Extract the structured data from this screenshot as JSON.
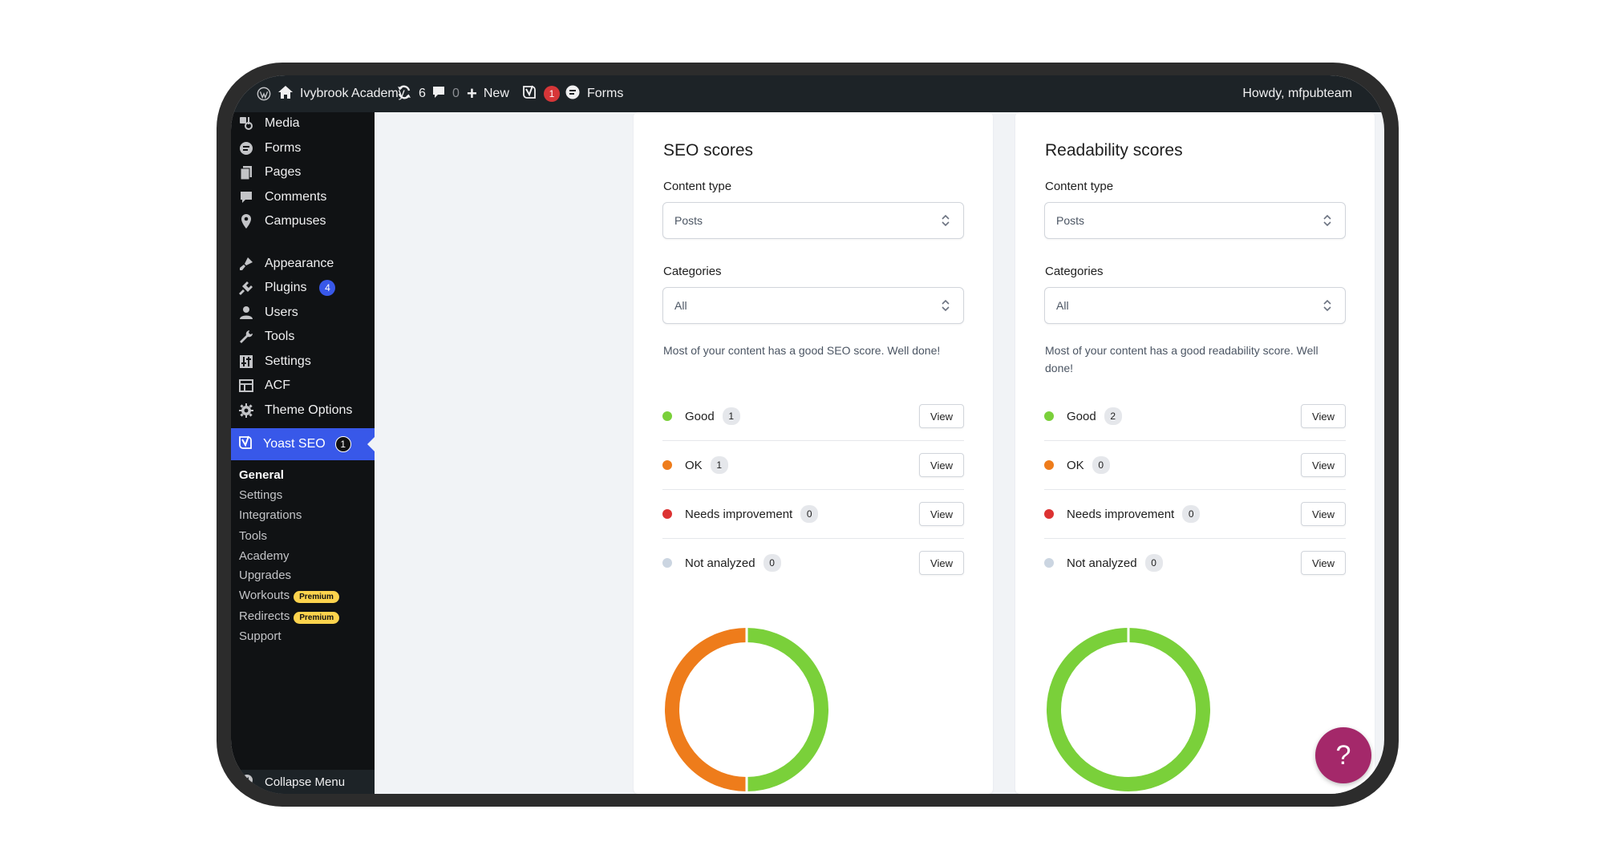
{
  "admin_bar": {
    "site_name": "Ivybrook Academy",
    "updates_count": "6",
    "comments_count": "0",
    "new_label": "New",
    "yoast_notifications": "1",
    "forms_label": "Forms",
    "greeting": "Howdy, mfpubteam"
  },
  "sidebar": {
    "items": [
      {
        "label": "Media",
        "icon": "media-icon"
      },
      {
        "label": "Forms",
        "icon": "forms-icon"
      },
      {
        "label": "Pages",
        "icon": "pages-icon"
      },
      {
        "label": "Comments",
        "icon": "comments-icon"
      },
      {
        "label": "Campuses",
        "icon": "location-pin-icon"
      },
      {
        "label": "Appearance",
        "icon": "paintbrush-icon"
      },
      {
        "label": "Plugins",
        "icon": "plugins-icon",
        "badge": "4"
      },
      {
        "label": "Users",
        "icon": "users-icon"
      },
      {
        "label": "Tools",
        "icon": "wrench-icon"
      },
      {
        "label": "Settings",
        "icon": "settings-icon"
      },
      {
        "label": "ACF",
        "icon": "acf-icon"
      },
      {
        "label": "Theme Options",
        "icon": "gear-icon"
      }
    ],
    "yoast": {
      "label": "Yoast SEO",
      "badge": "1"
    },
    "submenu": [
      {
        "label": "General"
      },
      {
        "label": "Settings"
      },
      {
        "label": "Integrations"
      },
      {
        "label": "Tools"
      },
      {
        "label": "Academy"
      },
      {
        "label": "Upgrades"
      },
      {
        "label": "Workouts",
        "premium": "Premium"
      },
      {
        "label": "Redirects",
        "premium": "Premium"
      },
      {
        "label": "Support"
      }
    ],
    "collapse_label": "Collapse Menu"
  },
  "seo_card": {
    "title": "SEO scores",
    "content_type_label": "Content type",
    "content_type_value": "Posts",
    "categories_label": "Categories",
    "categories_value": "All",
    "description": "Most of your content has a good SEO score. Well done!",
    "rows": [
      {
        "label": "Good",
        "count": "1",
        "button": "View"
      },
      {
        "label": "OK",
        "count": "1",
        "button": "View"
      },
      {
        "label": "Needs improvement",
        "count": "0",
        "button": "View"
      },
      {
        "label": "Not analyzed",
        "count": "0",
        "button": "View"
      }
    ]
  },
  "readability_card": {
    "title": "Readability scores",
    "content_type_label": "Content type",
    "content_type_value": "Posts",
    "categories_label": "Categories",
    "categories_value": "All",
    "description": "Most of your content has a good readability score. Well done!",
    "rows": [
      {
        "label": "Good",
        "count": "2",
        "button": "View"
      },
      {
        "label": "OK",
        "count": "0",
        "button": "View"
      },
      {
        "label": "Needs improvement",
        "count": "0",
        "button": "View"
      },
      {
        "label": "Not analyzed",
        "count": "0",
        "button": "View"
      }
    ]
  },
  "colors": {
    "good": "#7ad03a",
    "ok": "#ee7c1b",
    "bad": "#dc3232",
    "not_analyzed": "#cbd5e1",
    "accent": "#3858e9",
    "help": "#a4286a"
  },
  "help_button": "?"
}
